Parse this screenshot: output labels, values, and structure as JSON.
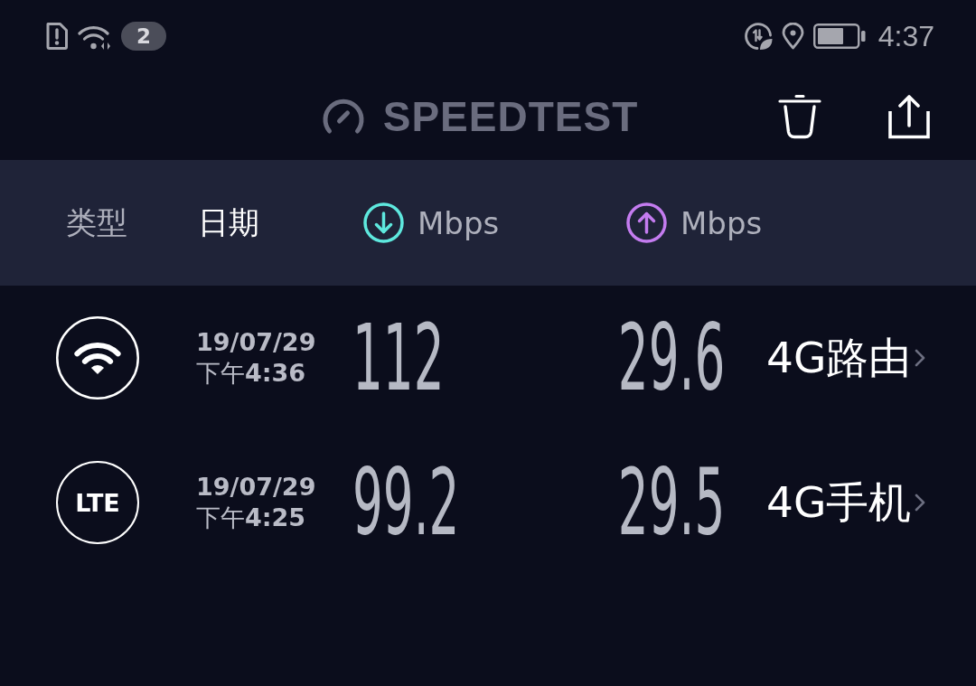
{
  "status_bar": {
    "notification_count": "2",
    "time": "4:37"
  },
  "header": {
    "title": "SPEEDTEST"
  },
  "columns": [
    {
      "kind": "text",
      "label": "类型",
      "selected": false
    },
    {
      "kind": "text",
      "label": "日期",
      "selected": true
    },
    {
      "kind": "download",
      "label": "Mbps",
      "selected": false
    },
    {
      "kind": "upload",
      "label": "Mbps",
      "selected": false
    }
  ],
  "results": [
    {
      "connection": {
        "kind": "wifi"
      },
      "date": "19/07/29",
      "time": "下午**4:36**",
      "download": "112",
      "upload": "29.6",
      "name": "4G路由"
    },
    {
      "connection": {
        "kind": "lte",
        "label": "LTE"
      },
      "date": "19/07/29",
      "time": "下午**4:25**",
      "download": "99.2",
      "upload": "29.5",
      "name": "4G手机"
    }
  ]
}
